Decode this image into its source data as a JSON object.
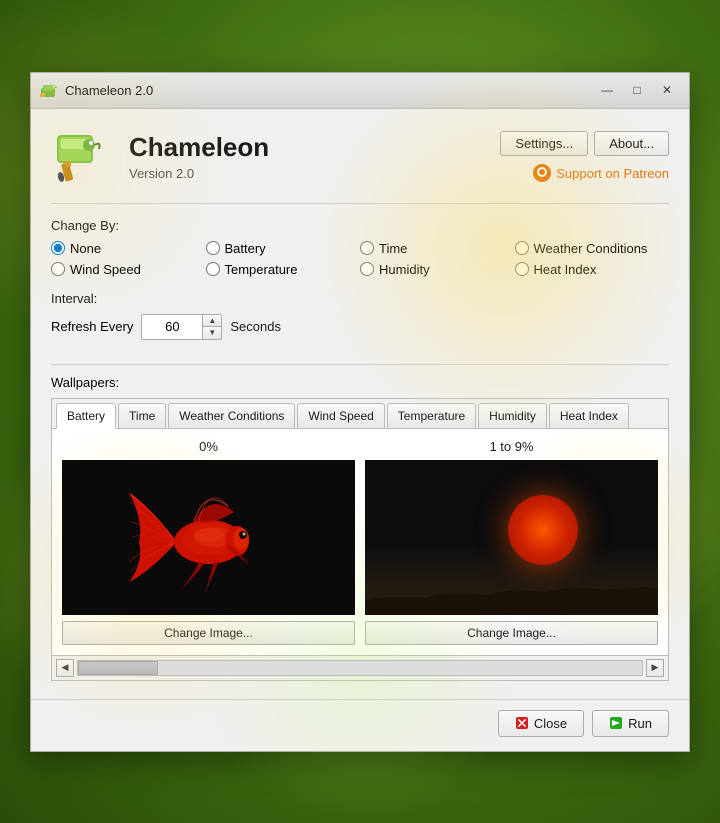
{
  "titleBar": {
    "icon": "🦎",
    "title": "Chameleon 2.0",
    "minimize": "—",
    "maximize": "□",
    "close": "✕"
  },
  "header": {
    "appName": "Chameleon",
    "version": "Version 2.0",
    "settingsBtn": "Settings...",
    "aboutBtn": "About...",
    "patreonText": "Support on Patreon"
  },
  "changeBy": {
    "label": "Change By:",
    "options": [
      {
        "id": "none",
        "label": "None",
        "checked": true
      },
      {
        "id": "battery",
        "label": "Battery",
        "checked": false
      },
      {
        "id": "time",
        "label": "Time",
        "checked": false
      },
      {
        "id": "weatherConditions",
        "label": "Weather Conditions",
        "checked": false
      },
      {
        "id": "windSpeed",
        "label": "Wind Speed",
        "checked": false
      },
      {
        "id": "temperature",
        "label": "Temperature",
        "checked": false
      },
      {
        "id": "humidity",
        "label": "Humidity",
        "checked": false
      },
      {
        "id": "heatIndex",
        "label": "Heat Index",
        "checked": false
      }
    ]
  },
  "interval": {
    "label": "Interval:",
    "refreshLabel": "Refresh Every",
    "value": "60",
    "secondsLabel": "Seconds"
  },
  "wallpapers": {
    "label": "Wallpapers:",
    "tabs": [
      {
        "id": "battery",
        "label": "Battery",
        "active": true
      },
      {
        "id": "time",
        "label": "Time",
        "active": false
      },
      {
        "id": "weatherConditions",
        "label": "Weather Conditions",
        "active": false
      },
      {
        "id": "windSpeed",
        "label": "Wind Speed",
        "active": false
      },
      {
        "id": "temperature",
        "label": "Temperature",
        "active": false
      },
      {
        "id": "humidity",
        "label": "Humidity",
        "active": false
      },
      {
        "id": "heatIndex",
        "label": "Heat Index",
        "active": false
      }
    ],
    "items": [
      {
        "title": "0%",
        "changeBtn": "Change Image..."
      },
      {
        "title": "1 to 9%",
        "changeBtn": "Change Image..."
      }
    ]
  },
  "footer": {
    "closeBtn": "Close",
    "runBtn": "Run"
  }
}
